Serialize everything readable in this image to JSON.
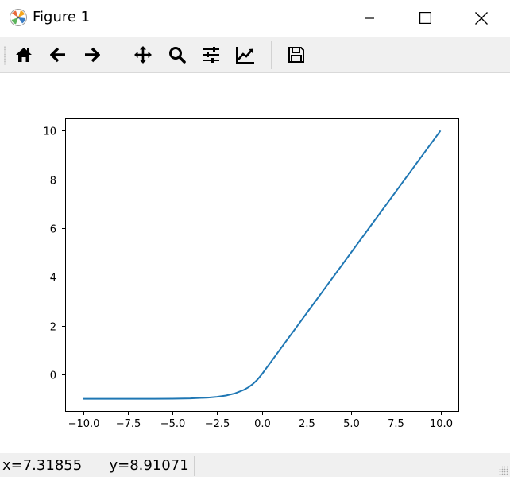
{
  "window": {
    "title": "Figure 1",
    "icon": "matplotlib-icon"
  },
  "controls": {
    "minimize_icon": "minimize-icon",
    "maximize_icon": "maximize-icon",
    "close_icon": "close-icon"
  },
  "toolbar": {
    "tools": [
      {
        "name": "home",
        "icon": "home-icon"
      },
      {
        "name": "back",
        "icon": "arrow-left-icon"
      },
      {
        "name": "forward",
        "icon": "arrow-right-icon"
      },
      {
        "name": "pan",
        "icon": "move-icon"
      },
      {
        "name": "zoom",
        "icon": "magnifier-icon"
      },
      {
        "name": "subplots",
        "icon": "sliders-icon"
      },
      {
        "name": "customize",
        "icon": "line-chart-icon"
      },
      {
        "name": "save",
        "icon": "save-icon"
      }
    ]
  },
  "status": {
    "coords": "x=7.31855      y=8.91071"
  },
  "colors": {
    "line": "#1f77b4",
    "toolbar_bg": "#f0f0f0"
  },
  "chart_data": {
    "type": "line",
    "title": "",
    "xlabel": "",
    "ylabel": "",
    "xlim": [
      -11.0,
      11.0
    ],
    "ylim": [
      -1.5,
      10.5
    ],
    "xticks": [
      -10.0,
      -7.5,
      -5.0,
      -2.5,
      0.0,
      2.5,
      5.0,
      7.5,
      10.0
    ],
    "xtick_labels": [
      "−10.0",
      "−7.5",
      "−5.0",
      "−2.5",
      "0.0",
      "2.5",
      "5.0",
      "7.5",
      "10.0"
    ],
    "yticks": [
      0,
      2,
      4,
      6,
      8,
      10
    ],
    "ytick_labels": [
      "0",
      "2",
      "4",
      "6",
      "8",
      "10"
    ],
    "grid": false,
    "series": [
      {
        "x": [
          -10.0,
          -8.0,
          -6.0,
          -5.0,
          -4.0,
          -3.0,
          -2.5,
          -2.0,
          -1.5,
          -1.0,
          -0.75,
          -0.5,
          -0.25,
          0.0,
          0.5,
          1.0,
          2.0,
          4.0,
          6.0,
          8.0,
          10.0
        ],
        "y": [
          -1.0,
          -1.0,
          -0.998,
          -0.993,
          -0.982,
          -0.95,
          -0.918,
          -0.865,
          -0.777,
          -0.632,
          -0.528,
          -0.393,
          -0.221,
          0.0,
          0.5,
          1.0,
          2.0,
          4.0,
          6.0,
          8.0,
          10.0
        ]
      }
    ]
  }
}
